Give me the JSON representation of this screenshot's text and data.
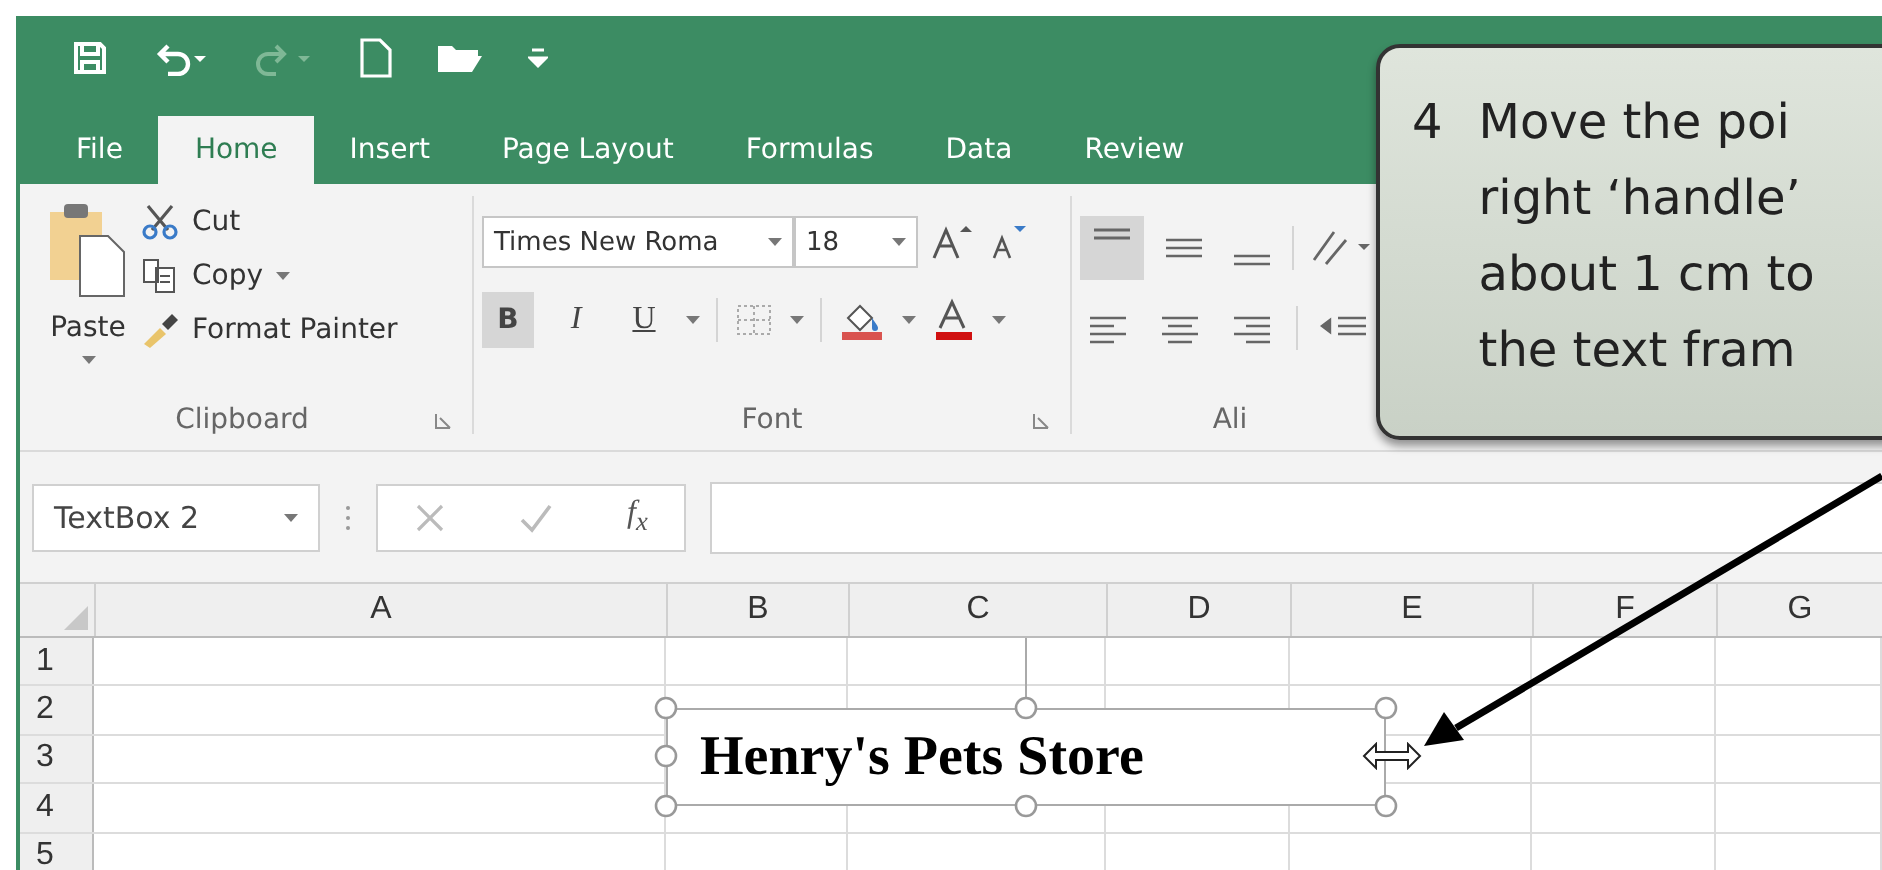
{
  "tabs": [
    {
      "label": "File",
      "selected": false
    },
    {
      "label": "Home",
      "selected": true
    },
    {
      "label": "Insert",
      "selected": false
    },
    {
      "label": "Page Layout",
      "selected": false
    },
    {
      "label": "Formulas",
      "selected": false
    },
    {
      "label": "Data",
      "selected": false
    },
    {
      "label": "Review",
      "selected": false
    }
  ],
  "clipboard": {
    "paste": "Paste",
    "cut": "Cut",
    "copy": "Copy",
    "format_painter": "Format Painter",
    "group": "Clipboard"
  },
  "font": {
    "name": "Times New Roma",
    "size": "18",
    "group": "Font",
    "styles": [
      {
        "kind": "bold",
        "label": "B",
        "selected": true
      },
      {
        "kind": "italic",
        "label": "I",
        "selected": false
      },
      {
        "kind": "underline",
        "label": "U",
        "selected": false
      }
    ]
  },
  "alignment": {
    "top_align": true,
    "group": "Ali"
  },
  "formula_bar": {
    "name_box": "TextBox 2",
    "fx": "f$_{x}$"
  },
  "sheet": {
    "columns": [
      "A",
      "B",
      "C",
      "D",
      "E",
      "F",
      "G"
    ],
    "rows": [
      "1",
      "2",
      "3",
      "4",
      "5"
    ]
  },
  "textbox": {
    "text": "Henry's Pets Store",
    "selected": true
  },
  "callout": {
    "step": "4",
    "lines": [
      "Move the poi",
      "right ‘handle’",
      "about 1 cm to",
      "the text fram"
    ]
  }
}
